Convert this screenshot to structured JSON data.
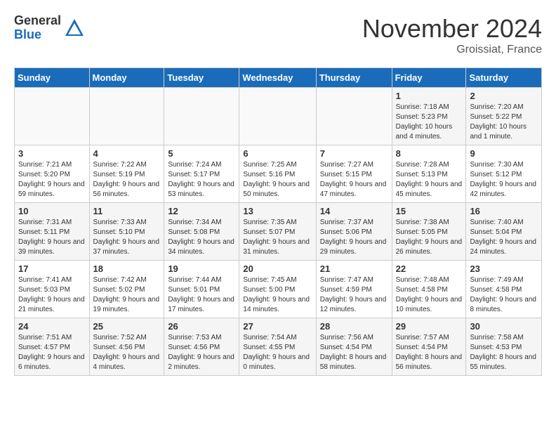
{
  "logo": {
    "general": "General",
    "blue": "Blue"
  },
  "header": {
    "month": "November 2024",
    "location": "Groissiat, France"
  },
  "weekdays": [
    "Sunday",
    "Monday",
    "Tuesday",
    "Wednesday",
    "Thursday",
    "Friday",
    "Saturday"
  ],
  "weeks": [
    [
      {
        "day": "",
        "info": ""
      },
      {
        "day": "",
        "info": ""
      },
      {
        "day": "",
        "info": ""
      },
      {
        "day": "",
        "info": ""
      },
      {
        "day": "",
        "info": ""
      },
      {
        "day": "1",
        "info": "Sunrise: 7:18 AM\nSunset: 5:23 PM\nDaylight: 10 hours and 4 minutes."
      },
      {
        "day": "2",
        "info": "Sunrise: 7:20 AM\nSunset: 5:22 PM\nDaylight: 10 hours and 1 minute."
      }
    ],
    [
      {
        "day": "3",
        "info": "Sunrise: 7:21 AM\nSunset: 5:20 PM\nDaylight: 9 hours and 59 minutes."
      },
      {
        "day": "4",
        "info": "Sunrise: 7:22 AM\nSunset: 5:19 PM\nDaylight: 9 hours and 56 minutes."
      },
      {
        "day": "5",
        "info": "Sunrise: 7:24 AM\nSunset: 5:17 PM\nDaylight: 9 hours and 53 minutes."
      },
      {
        "day": "6",
        "info": "Sunrise: 7:25 AM\nSunset: 5:16 PM\nDaylight: 9 hours and 50 minutes."
      },
      {
        "day": "7",
        "info": "Sunrise: 7:27 AM\nSunset: 5:15 PM\nDaylight: 9 hours and 47 minutes."
      },
      {
        "day": "8",
        "info": "Sunrise: 7:28 AM\nSunset: 5:13 PM\nDaylight: 9 hours and 45 minutes."
      },
      {
        "day": "9",
        "info": "Sunrise: 7:30 AM\nSunset: 5:12 PM\nDaylight: 9 hours and 42 minutes."
      }
    ],
    [
      {
        "day": "10",
        "info": "Sunrise: 7:31 AM\nSunset: 5:11 PM\nDaylight: 9 hours and 39 minutes."
      },
      {
        "day": "11",
        "info": "Sunrise: 7:33 AM\nSunset: 5:10 PM\nDaylight: 9 hours and 37 minutes."
      },
      {
        "day": "12",
        "info": "Sunrise: 7:34 AM\nSunset: 5:08 PM\nDaylight: 9 hours and 34 minutes."
      },
      {
        "day": "13",
        "info": "Sunrise: 7:35 AM\nSunset: 5:07 PM\nDaylight: 9 hours and 31 minutes."
      },
      {
        "day": "14",
        "info": "Sunrise: 7:37 AM\nSunset: 5:06 PM\nDaylight: 9 hours and 29 minutes."
      },
      {
        "day": "15",
        "info": "Sunrise: 7:38 AM\nSunset: 5:05 PM\nDaylight: 9 hours and 26 minutes."
      },
      {
        "day": "16",
        "info": "Sunrise: 7:40 AM\nSunset: 5:04 PM\nDaylight: 9 hours and 24 minutes."
      }
    ],
    [
      {
        "day": "17",
        "info": "Sunrise: 7:41 AM\nSunset: 5:03 PM\nDaylight: 9 hours and 21 minutes."
      },
      {
        "day": "18",
        "info": "Sunrise: 7:42 AM\nSunset: 5:02 PM\nDaylight: 9 hours and 19 minutes."
      },
      {
        "day": "19",
        "info": "Sunrise: 7:44 AM\nSunset: 5:01 PM\nDaylight: 9 hours and 17 minutes."
      },
      {
        "day": "20",
        "info": "Sunrise: 7:45 AM\nSunset: 5:00 PM\nDaylight: 9 hours and 14 minutes."
      },
      {
        "day": "21",
        "info": "Sunrise: 7:47 AM\nSunset: 4:59 PM\nDaylight: 9 hours and 12 minutes."
      },
      {
        "day": "22",
        "info": "Sunrise: 7:48 AM\nSunset: 4:58 PM\nDaylight: 9 hours and 10 minutes."
      },
      {
        "day": "23",
        "info": "Sunrise: 7:49 AM\nSunset: 4:58 PM\nDaylight: 9 hours and 8 minutes."
      }
    ],
    [
      {
        "day": "24",
        "info": "Sunrise: 7:51 AM\nSunset: 4:57 PM\nDaylight: 9 hours and 6 minutes."
      },
      {
        "day": "25",
        "info": "Sunrise: 7:52 AM\nSunset: 4:56 PM\nDaylight: 9 hours and 4 minutes."
      },
      {
        "day": "26",
        "info": "Sunrise: 7:53 AM\nSunset: 4:56 PM\nDaylight: 9 hours and 2 minutes."
      },
      {
        "day": "27",
        "info": "Sunrise: 7:54 AM\nSunset: 4:55 PM\nDaylight: 9 hours and 0 minutes."
      },
      {
        "day": "28",
        "info": "Sunrise: 7:56 AM\nSunset: 4:54 PM\nDaylight: 8 hours and 58 minutes."
      },
      {
        "day": "29",
        "info": "Sunrise: 7:57 AM\nSunset: 4:54 PM\nDaylight: 8 hours and 56 minutes."
      },
      {
        "day": "30",
        "info": "Sunrise: 7:58 AM\nSunset: 4:53 PM\nDaylight: 8 hours and 55 minutes."
      }
    ]
  ]
}
